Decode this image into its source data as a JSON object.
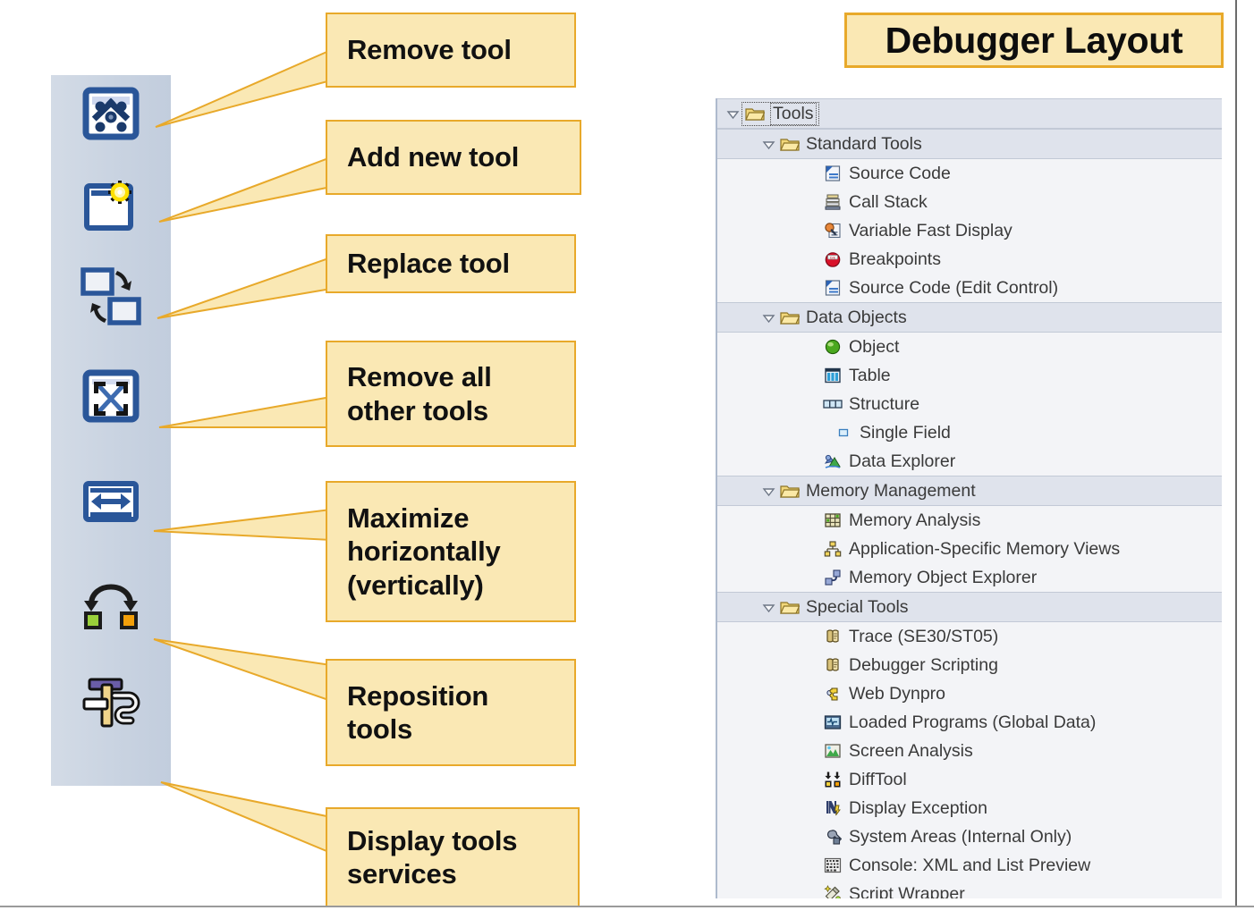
{
  "title": {
    "text": "Debugger Layout"
  },
  "toolbar": {
    "buttons": [
      {
        "name": "remove-tool",
        "icon": "remove-tool-icon"
      },
      {
        "name": "add-new-tool",
        "icon": "add-new-tool-icon"
      },
      {
        "name": "replace-tool",
        "icon": "replace-tool-icon"
      },
      {
        "name": "remove-all-other-tools",
        "icon": "remove-all-other-tools-icon"
      },
      {
        "name": "maximize-horizontally",
        "icon": "maximize-horizontally-icon"
      },
      {
        "name": "reposition-tools",
        "icon": "reposition-tools-icon"
      },
      {
        "name": "display-tools-services",
        "icon": "display-tools-services-icon"
      }
    ]
  },
  "callouts": [
    {
      "lines": [
        "Remove tool"
      ]
    },
    {
      "lines": [
        "Add new tool"
      ]
    },
    {
      "lines": [
        "Replace tool"
      ]
    },
    {
      "lines": [
        "Remove all",
        "other tools"
      ]
    },
    {
      "lines": [
        "Maximize",
        "horizontally",
        "(vertically)"
      ]
    },
    {
      "lines": [
        "Reposition",
        "tools"
      ]
    },
    {
      "lines": [
        "Display tools",
        "services"
      ]
    }
  ],
  "tree": {
    "root": {
      "label": "Tools",
      "icon": "folder-open-icon",
      "expanded": true,
      "selected": true
    },
    "groups": [
      {
        "label": "Standard Tools",
        "icon": "folder-open-icon",
        "expanded": true,
        "items": [
          {
            "label": "Source Code",
            "icon": "source-code-icon"
          },
          {
            "label": "Call Stack",
            "icon": "call-stack-icon"
          },
          {
            "label": "Variable Fast Display",
            "icon": "variable-fast-display-icon"
          },
          {
            "label": "Breakpoints",
            "icon": "breakpoints-icon"
          },
          {
            "label": "Source Code (Edit Control)",
            "icon": "source-code-icon"
          }
        ]
      },
      {
        "label": "Data Objects",
        "icon": "folder-open-icon",
        "expanded": true,
        "items": [
          {
            "label": "Object",
            "icon": "object-sphere-icon"
          },
          {
            "label": "Table",
            "icon": "table-icon"
          },
          {
            "label": "Structure",
            "icon": "structure-icon"
          },
          {
            "label": "Single Field",
            "icon": "single-field-icon",
            "extraIndent": true
          },
          {
            "label": "Data Explorer",
            "icon": "data-explorer-icon"
          }
        ]
      },
      {
        "label": "Memory Management",
        "icon": "folder-open-icon",
        "expanded": true,
        "items": [
          {
            "label": "Memory Analysis",
            "icon": "memory-analysis-icon"
          },
          {
            "label": "Application-Specific Memory Views",
            "icon": "app-specific-memory-views-icon"
          },
          {
            "label": "Memory Object Explorer",
            "icon": "memory-object-explorer-icon"
          }
        ]
      },
      {
        "label": "Special Tools",
        "icon": "folder-open-icon",
        "expanded": true,
        "items": [
          {
            "label": "Trace (SE30/ST05)",
            "icon": "scroll-icon"
          },
          {
            "label": "Debugger Scripting",
            "icon": "scroll-icon"
          },
          {
            "label": "Web Dynpro",
            "icon": "web-dynpro-icon"
          },
          {
            "label": "Loaded Programs (Global Data)",
            "icon": "loaded-programs-icon"
          },
          {
            "label": "Screen Analysis",
            "icon": "screen-analysis-icon"
          },
          {
            "label": "DiffTool",
            "icon": "difftool-icon"
          },
          {
            "label": "Display Exception",
            "icon": "display-exception-icon"
          },
          {
            "label": "System Areas (Internal Only)",
            "icon": "system-areas-icon"
          },
          {
            "label": "Console: XML and List Preview",
            "icon": "console-xml-icon"
          },
          {
            "label": "Script Wrapper",
            "icon": "script-wrapper-icon"
          }
        ]
      }
    ]
  },
  "colors": {
    "callout_fill": "#fae8b4",
    "callout_border": "#e8a92a",
    "toolbar_bg": "#ccd5e2",
    "tree_bg": "#f3f4f7",
    "tree_folder_row_bg": "#dfe3ec",
    "icon_blue": "#2a5699",
    "text": "#3c3c3c"
  }
}
